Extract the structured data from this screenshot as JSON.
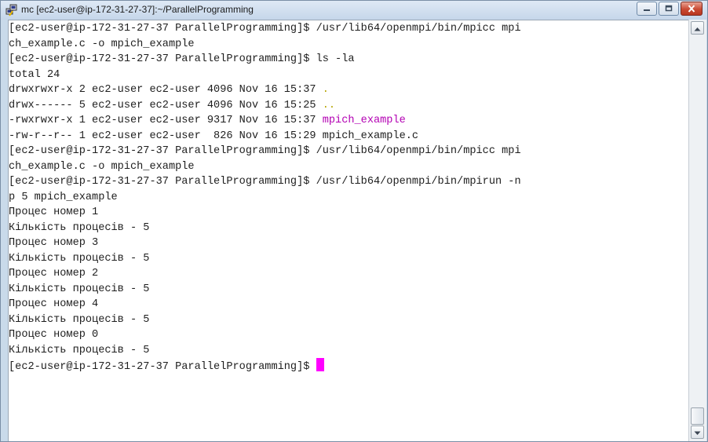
{
  "window": {
    "title": "mc [ec2-user@ip-172-31-27-37]:~/ParallelProgramming",
    "icon": "putty-icon",
    "controls": [
      "minimize-icon",
      "maximize-icon",
      "close-icon"
    ]
  },
  "terminal": {
    "background": "#ffffff",
    "foreground": "#1e1e1e",
    "directory_color": "#b5a400",
    "executable_color": "#b300b3",
    "cursor_color": "#ff00ff",
    "lines": [
      "[ec2-user@ip-172-31-27-37 ParallelProgramming]$ /usr/lib64/openmpi/bin/mpicc mpi",
      "ch_example.c -o mpich_example",
      "[ec2-user@ip-172-31-27-37 ParallelProgramming]$ ls -la",
      "total 24",
      {
        "pre": "drwxrwxr-x 2 ec2-user ec2-user 4096 Nov 16 15:37 ",
        "name": ".",
        "kind": "dir"
      },
      {
        "pre": "drwx------ 5 ec2-user ec2-user 4096 Nov 16 15:25 ",
        "name": "..",
        "kind": "dir"
      },
      {
        "pre": "-rwxrwxr-x 1 ec2-user ec2-user 9317 Nov 16 15:37 ",
        "name": "mpich_example",
        "kind": "exec"
      },
      "-rw-r--r-- 1 ec2-user ec2-user  826 Nov 16 15:29 mpich_example.c",
      "[ec2-user@ip-172-31-27-37 ParallelProgramming]$ /usr/lib64/openmpi/bin/mpicc mpi",
      "ch_example.c -o mpich_example",
      "[ec2-user@ip-172-31-27-37 ParallelProgramming]$ /usr/lib64/openmpi/bin/mpirun -n",
      "p 5 mpich_example",
      "Процес номер 1",
      "Кількість процесів - 5",
      "Процес номер 3",
      "Кількість процесів - 5",
      "Процес номер 2",
      "Кількість процесів - 5",
      "Процес номер 4",
      "Кількість процесів - 5",
      "Процес номер 0",
      "Кількість процесів - 5",
      {
        "pre": "[ec2-user@ip-172-31-27-37 ParallelProgramming]$ ",
        "cursor": true
      }
    ]
  },
  "scrollbar": {
    "up_icon": "scroll-up-arrow-icon",
    "down_icon": "scroll-down-arrow-icon"
  }
}
